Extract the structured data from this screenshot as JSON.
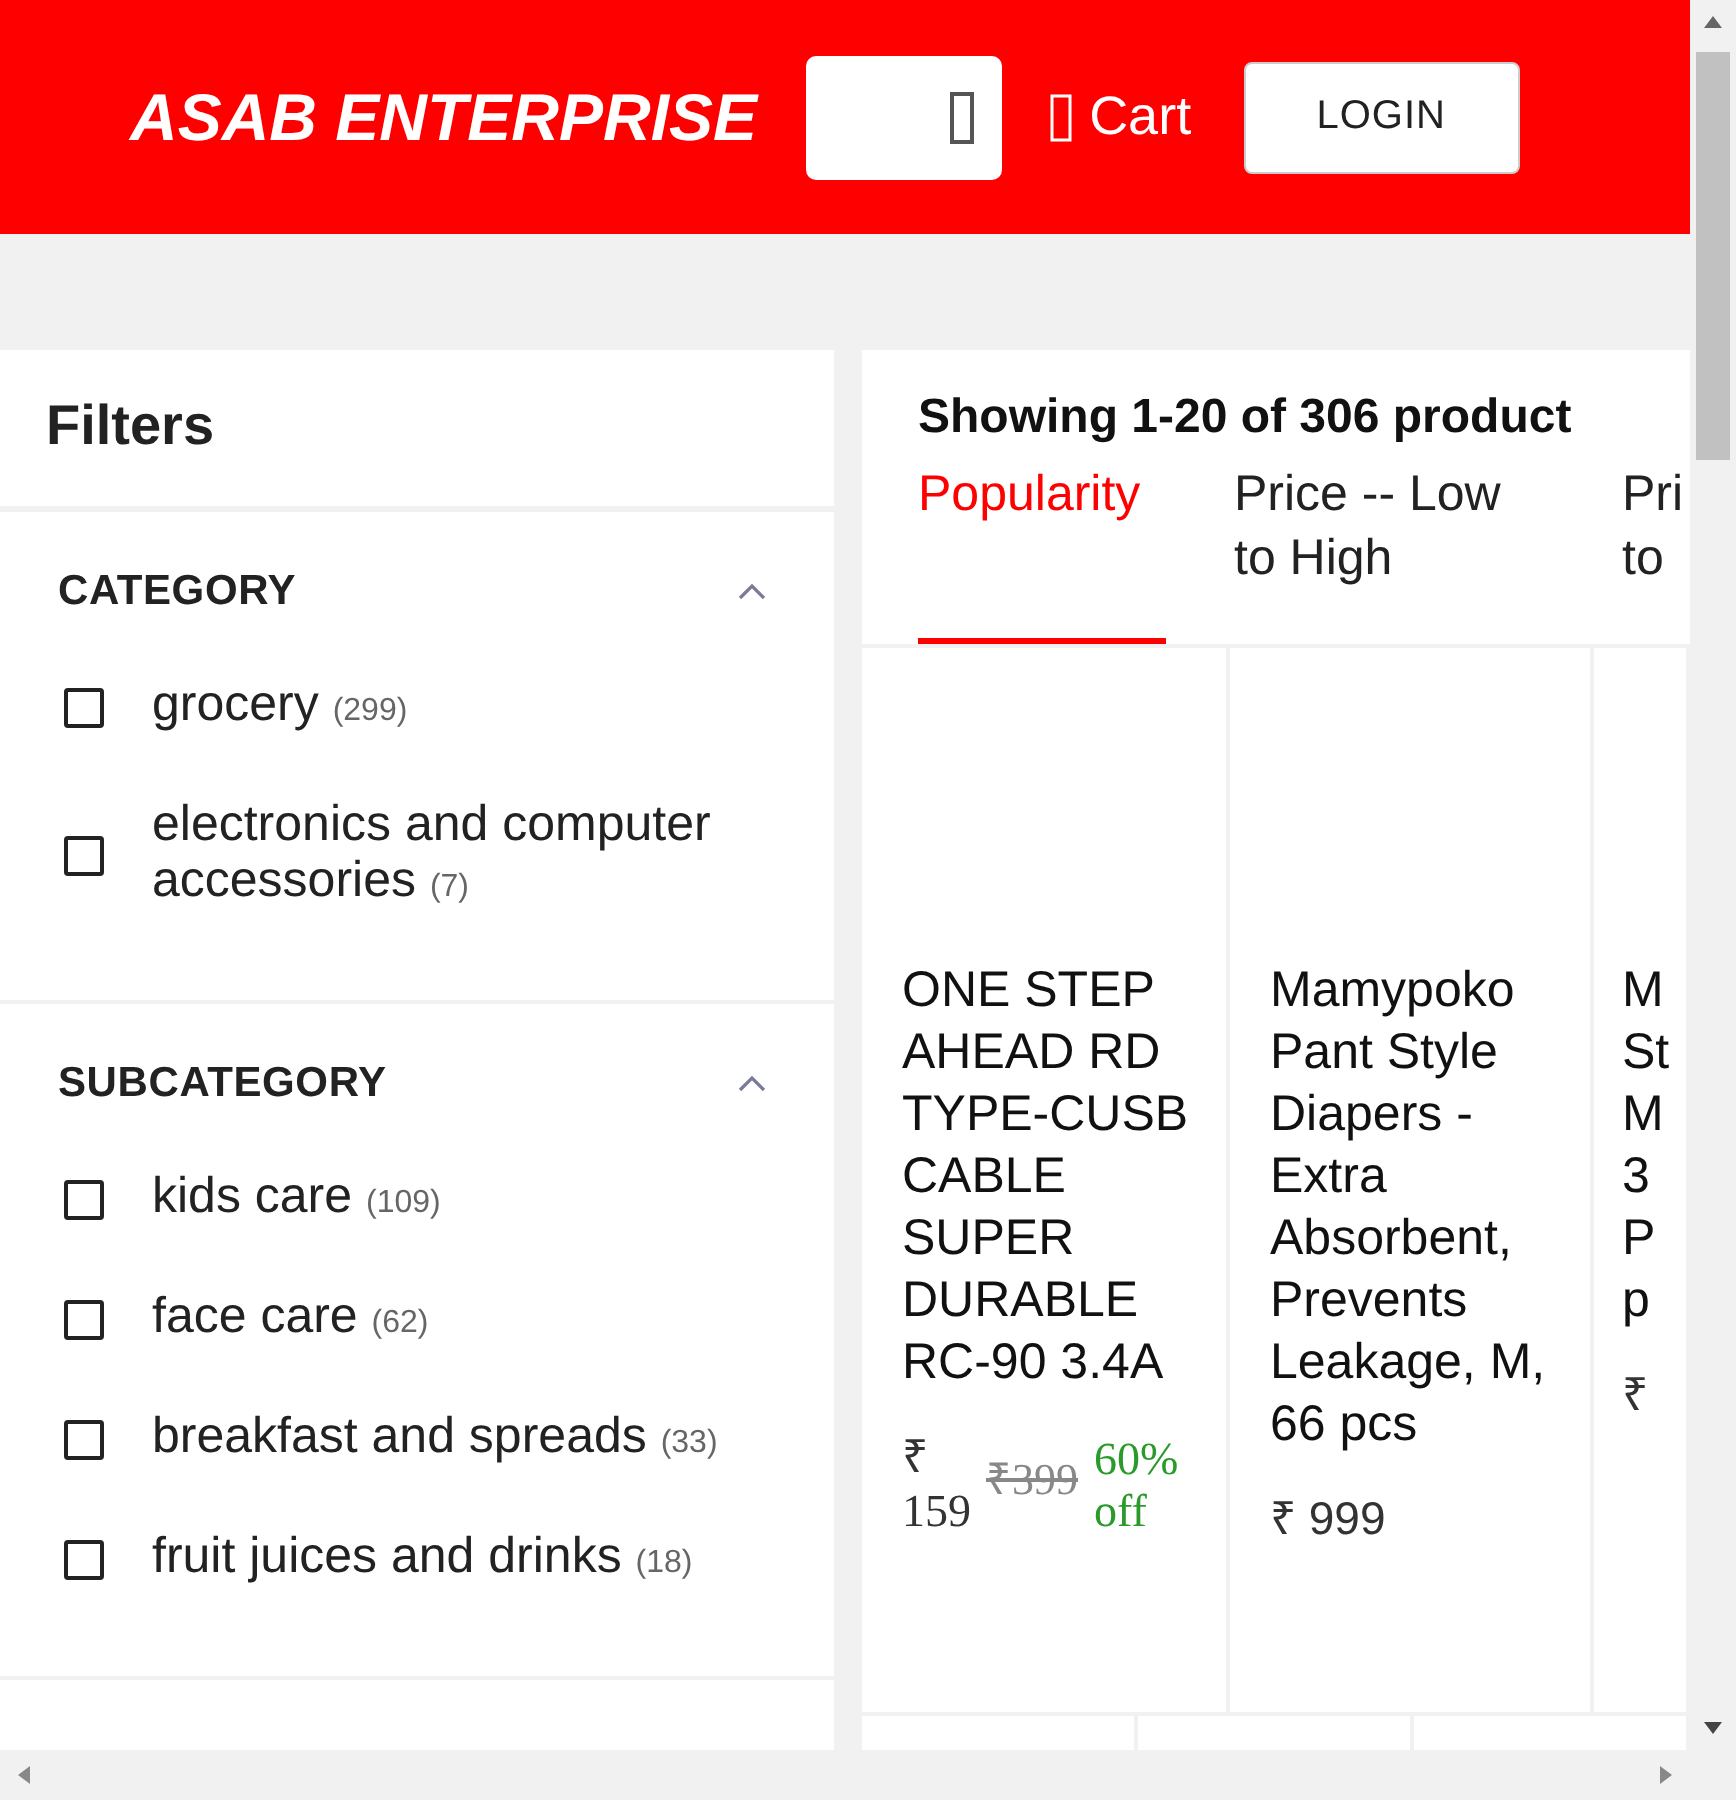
{
  "header": {
    "brand": "ASAB ENTERPRISE",
    "cart": "Cart",
    "login": "LOGIN"
  },
  "filters": {
    "title": "Filters",
    "sections": [
      {
        "title": "CATEGORY",
        "expanded": true,
        "items": [
          {
            "label": "grocery",
            "count": "(299)",
            "checked": false
          },
          {
            "label": "electronics and computer accessories",
            "count": "(7)",
            "checked": false
          }
        ]
      },
      {
        "title": "SUBCATEGORY",
        "expanded": true,
        "items": [
          {
            "label": "kids care",
            "count": "(109)",
            "checked": false
          },
          {
            "label": "face care",
            "count": "(62)",
            "checked": false
          },
          {
            "label": "breakfast and spreads",
            "count": "(33)",
            "checked": false
          },
          {
            "label": "fruit juices and drinks",
            "count": "(18)",
            "checked": false
          }
        ]
      }
    ]
  },
  "results": {
    "summary": "Showing 1-20 of 306 product",
    "sort_tabs": [
      {
        "label": "Popularity",
        "selected": true
      },
      {
        "label": "Price -- Low to High",
        "selected": false
      },
      {
        "label": "Pri to",
        "selected": false
      }
    ],
    "products": [
      {
        "name": "ONE STEP AHEAD RD TYPE-CUSB CABLE SUPER DURABLE RC-90 3.4A",
        "price": "₹ 159",
        "mrp": "₹399",
        "discount": "60% off"
      },
      {
        "name": "Mamypoko Pant Style Diapers - Extra Absorbent, Prevents Leakage, M, 66 pcs",
        "price": "₹ 999"
      },
      {
        "name": "M St M 3 P p",
        "price": "₹"
      }
    ]
  }
}
